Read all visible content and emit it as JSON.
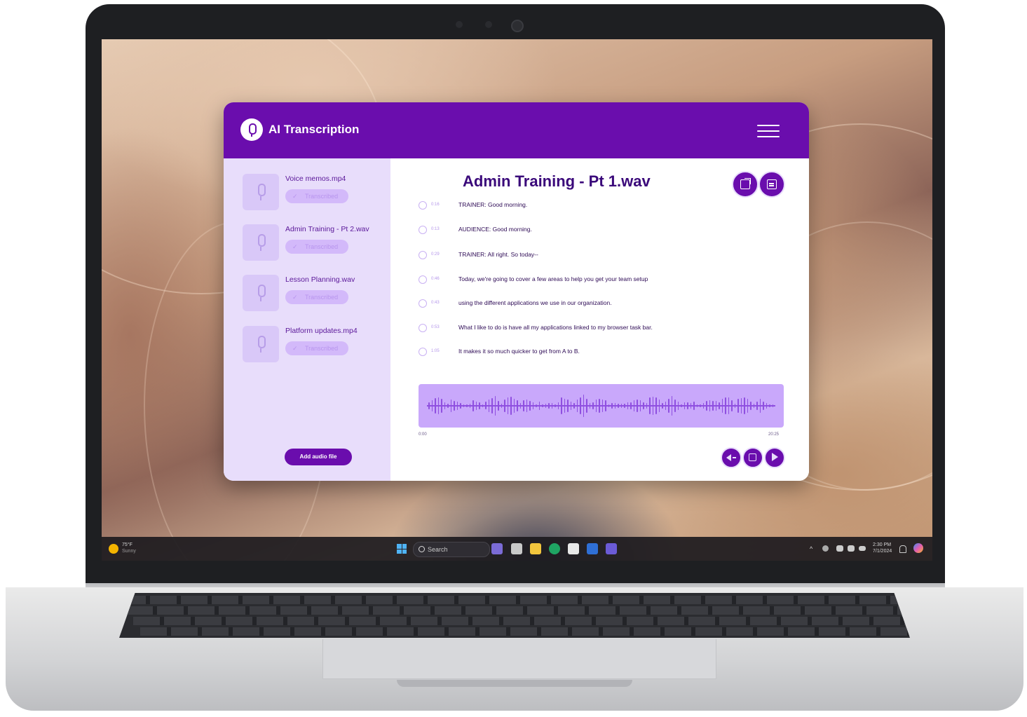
{
  "app": {
    "title": "AI Transcription"
  },
  "sidebar": {
    "files": [
      {
        "name": "Voice memos.mp4",
        "status": "Transcribed"
      },
      {
        "name": "Admin Training - Pt 2.wav",
        "status": "Transcribed"
      },
      {
        "name": "Lesson Planning.wav",
        "status": "Transcribed"
      },
      {
        "name": "Platform updates.mp4",
        "status": "Transcribed"
      }
    ],
    "add_button": "Add audio file"
  },
  "main": {
    "title": "Admin Training - Pt 1.wav",
    "lines": [
      {
        "time": "0:16",
        "text": "TRAINER: Good morning."
      },
      {
        "time": "0:13",
        "text": "AUDIENCE: Good morning."
      },
      {
        "time": "0:29",
        "text": "TRAINER: All right. So today--"
      },
      {
        "time": "0:46",
        "text": "Today, we're going to cover a few areas to help you get your team setup"
      },
      {
        "time": "0:43",
        "text": "using the different applications we use in our organization."
      },
      {
        "time": "0:53",
        "text": "What I like to do is have all my applications linked to my browser task bar."
      },
      {
        "time": "1:05",
        "text": "It makes it so much quicker to get from A to B."
      }
    ],
    "player": {
      "start_time": "0:00",
      "end_time": "20:25"
    }
  },
  "taskbar": {
    "weather_temp": "75°F",
    "weather_desc": "Sunny",
    "search_placeholder": "Search",
    "clock_time": "2:30 PM",
    "clock_date": "7/1/2024"
  },
  "colors": {
    "primary": "#6a0dad",
    "sidebar_bg": "#e8ddfb",
    "waveform_bg": "#c9a8fb",
    "badge_bg": "#d3b9fa"
  },
  "icons": {
    "logo": "microphone-icon",
    "menu": "hamburger-menu-icon",
    "export": "export-icon",
    "document": "document-icon",
    "mute": "mute-icon",
    "stop": "stop-icon",
    "play": "play-icon"
  }
}
